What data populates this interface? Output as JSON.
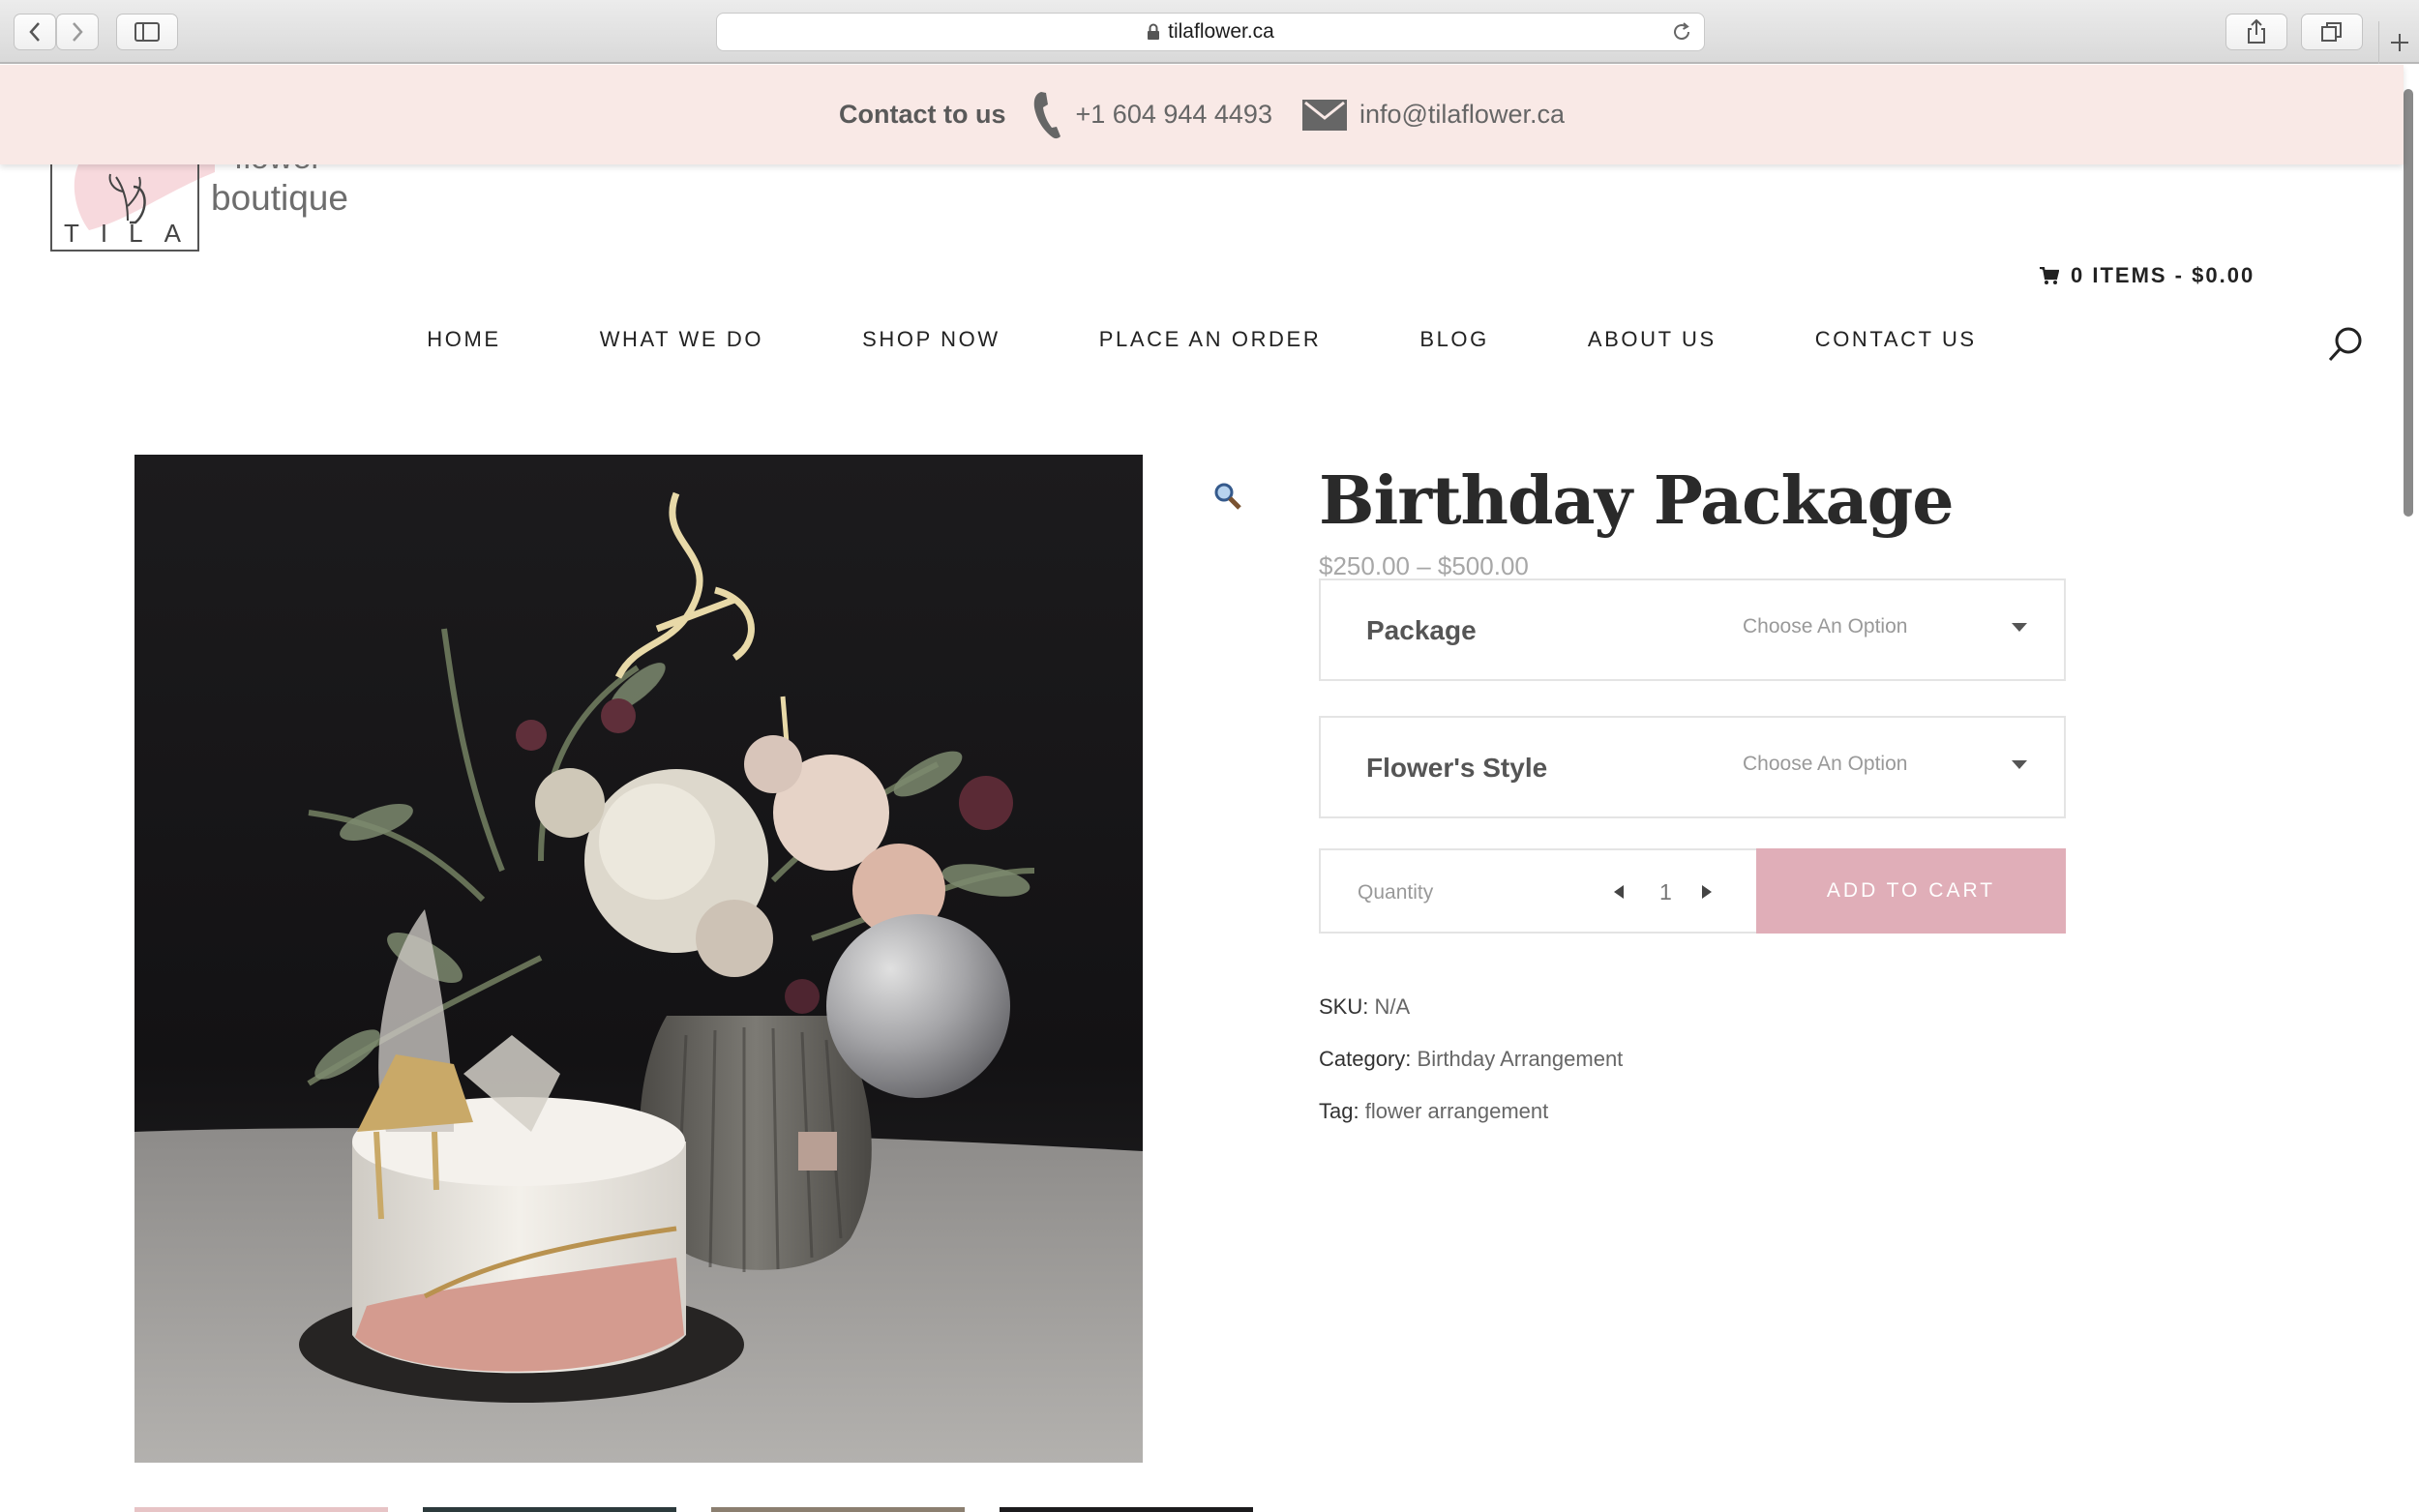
{
  "browser": {
    "url": "tilaflower.ca"
  },
  "contact_bar": {
    "label": "Contact to us",
    "phone": "+1 604 944 4493",
    "email": "info@tilaflower.ca"
  },
  "logo": {
    "tila": "TILA",
    "line1": "flower",
    "line2": "boutique"
  },
  "cart": {
    "summary": "0 ITEMS - $0.00"
  },
  "nav": {
    "items": [
      "HOME",
      "WHAT WE DO",
      "SHOP NOW",
      "PLACE AN ORDER",
      "BLOG",
      "ABOUT US",
      "CONTACT US"
    ]
  },
  "product": {
    "title": "Birthday Package",
    "price": "$250.00 – $500.00",
    "variants": [
      {
        "label": "Package",
        "selected": "Choose An Option"
      },
      {
        "label": "Flower's Style",
        "selected": "Choose An Option"
      }
    ],
    "quantity_label": "Quantity",
    "quantity_value": "1",
    "add_to_cart": "ADD TO CART",
    "sku_label": "SKU:",
    "sku_value": "N/A",
    "category_label": "Category:",
    "category_value": "Birthday Arrangement",
    "tag_label": "Tag:",
    "tag_value": "flower arrangement"
  },
  "colors": {
    "contact_bar_bg": "#f9e9e6",
    "add_to_cart_bg": "#e0aeb8"
  }
}
